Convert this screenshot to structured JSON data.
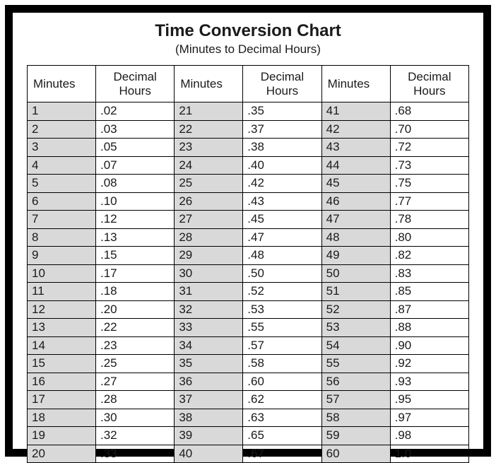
{
  "title": "Time Conversion Chart",
  "subtitle": "(Minutes to Decimal Hours)",
  "headers": {
    "minutes": "Minutes",
    "decimal": "Decimal Hours"
  },
  "chart_data": {
    "type": "table",
    "title": "Time Conversion Chart (Minutes to Decimal Hours)",
    "columns": [
      "Minutes",
      "Decimal Hours"
    ],
    "rows": [
      [
        1,
        ".02"
      ],
      [
        2,
        ".03"
      ],
      [
        3,
        ".05"
      ],
      [
        4,
        ".07"
      ],
      [
        5,
        ".08"
      ],
      [
        6,
        ".10"
      ],
      [
        7,
        ".12"
      ],
      [
        8,
        ".13"
      ],
      [
        9,
        ".15"
      ],
      [
        10,
        ".17"
      ],
      [
        11,
        ".18"
      ],
      [
        12,
        ".20"
      ],
      [
        13,
        ".22"
      ],
      [
        14,
        ".23"
      ],
      [
        15,
        ".25"
      ],
      [
        16,
        ".27"
      ],
      [
        17,
        ".28"
      ],
      [
        18,
        ".30"
      ],
      [
        19,
        ".32"
      ],
      [
        20,
        ".33"
      ],
      [
        21,
        ".35"
      ],
      [
        22,
        ".37"
      ],
      [
        23,
        ".38"
      ],
      [
        24,
        ".40"
      ],
      [
        25,
        ".42"
      ],
      [
        26,
        ".43"
      ],
      [
        27,
        ".45"
      ],
      [
        28,
        ".47"
      ],
      [
        29,
        ".48"
      ],
      [
        30,
        ".50"
      ],
      [
        31,
        ".52"
      ],
      [
        32,
        ".53"
      ],
      [
        33,
        ".55"
      ],
      [
        34,
        ".57"
      ],
      [
        35,
        ".58"
      ],
      [
        36,
        ".60"
      ],
      [
        37,
        ".62"
      ],
      [
        38,
        ".63"
      ],
      [
        39,
        ".65"
      ],
      [
        40,
        ".67"
      ],
      [
        41,
        ".68"
      ],
      [
        42,
        ".70"
      ],
      [
        43,
        ".72"
      ],
      [
        44,
        ".73"
      ],
      [
        45,
        ".75"
      ],
      [
        46,
        ".77"
      ],
      [
        47,
        ".78"
      ],
      [
        48,
        ".80"
      ],
      [
        49,
        ".82"
      ],
      [
        50,
        ".83"
      ],
      [
        51,
        ".85"
      ],
      [
        52,
        ".87"
      ],
      [
        53,
        ".88"
      ],
      [
        54,
        ".90"
      ],
      [
        55,
        ".92"
      ],
      [
        56,
        ".93"
      ],
      [
        57,
        ".95"
      ],
      [
        58,
        ".97"
      ],
      [
        59,
        ".98"
      ],
      [
        60,
        "1.0"
      ]
    ]
  }
}
